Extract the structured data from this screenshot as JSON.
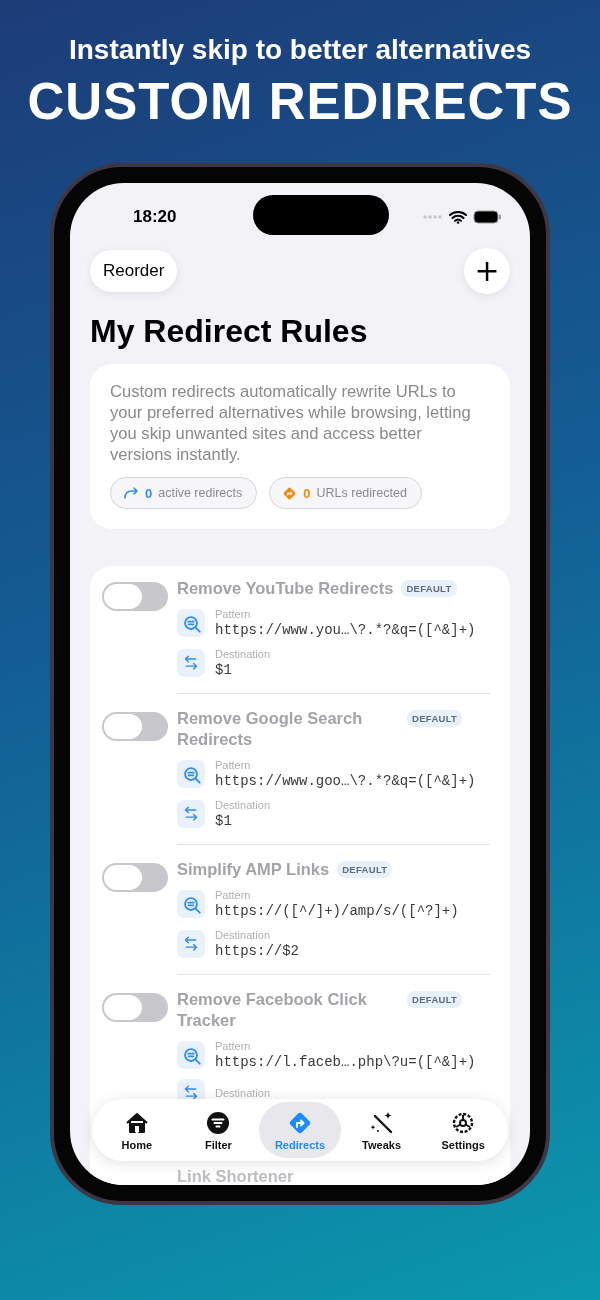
{
  "headline": {
    "tagline": "Instantly skip to better alternatives",
    "title": "CUSTOM REDIRECTS"
  },
  "status_bar": {
    "time": "18:20"
  },
  "toolbar": {
    "left_button": "Reorder",
    "right_button": "+"
  },
  "page_title": "My Redirect Rules",
  "intro": {
    "text": "Custom redirects automatically rewrite URLs to your preferred alternatives while browsing, letting you skip unwanted sites and access better versions instantly.",
    "stats": [
      {
        "kind": "active",
        "count": "0",
        "label": "active redirects",
        "color": "#2f8cf0"
      },
      {
        "kind": "redirected",
        "count": "0",
        "label": "URLs redirected",
        "color": "#f5890f"
      }
    ]
  },
  "rules": [
    {
      "title": "Remove YouTube Redirects",
      "badge": "DEFAULT",
      "on": false,
      "pattern_label": "Pattern",
      "pattern": "https://www.you…\\?.*?&q=([^&]+)",
      "destination_label": "Destination",
      "destination": "$1"
    },
    {
      "title": "Remove Google Search Redirects",
      "badge": "DEFAULT",
      "on": false,
      "pattern_label": "Pattern",
      "pattern": "https://www.goo…\\?.*?&q=([^&]+)",
      "destination_label": "Destination",
      "destination": "$1"
    },
    {
      "title": "Simplify AMP Links",
      "badge": "DEFAULT",
      "on": false,
      "pattern_label": "Pattern",
      "pattern": "https://([^/]+)/amp/s/([^?]+)",
      "destination_label": "Destination",
      "destination": "https://$2"
    },
    {
      "title": "Remove Facebook Click Tracker",
      "badge": "DEFAULT",
      "on": false,
      "pattern_label": "Pattern",
      "pattern": "https://l.faceb….php\\?u=([^&]+)",
      "destination_label": "Destination"
    },
    {
      "title": "Link Shortener"
    }
  ],
  "tab_bar": [
    {
      "kind": "home",
      "label": "Home",
      "selected": false
    },
    {
      "kind": "filter",
      "label": "Filter",
      "selected": false
    },
    {
      "kind": "redirects",
      "label": "Redirects",
      "selected": true
    },
    {
      "kind": "tweaks",
      "label": "Tweaks",
      "selected": false
    },
    {
      "kind": "settings",
      "label": "Settings",
      "selected": false
    }
  ]
}
